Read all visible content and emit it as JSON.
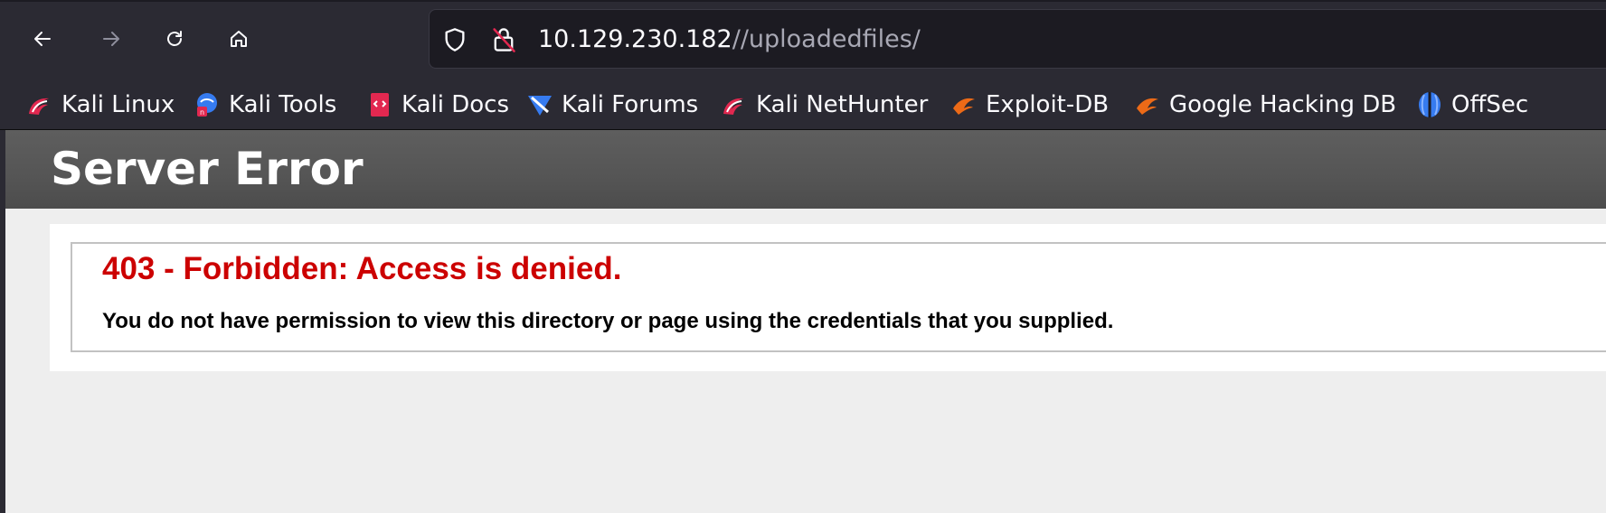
{
  "browser": {
    "nav": {
      "back": "back-icon",
      "forward": "forward-icon",
      "reload": "reload-icon",
      "home": "home-icon"
    },
    "urlbar": {
      "host": "10.129.230.182",
      "path": "//uploadedfiles/",
      "security_icon": "shield-icon",
      "lock_icon": "insecure-lock-icon"
    },
    "bookmarks": [
      {
        "label": "Kali Linux",
        "icon": "kali-dragon-icon"
      },
      {
        "label": "Kali Tools",
        "icon": "kali-tools-icon"
      },
      {
        "label": "Kali Docs",
        "icon": "kali-docs-icon"
      },
      {
        "label": "Kali Forums",
        "icon": "kali-forums-icon"
      },
      {
        "label": "Kali NetHunter",
        "icon": "kali-nethunter-icon"
      },
      {
        "label": "Exploit-DB",
        "icon": "exploit-db-icon"
      },
      {
        "label": "Google Hacking DB",
        "icon": "ghdb-icon"
      },
      {
        "label": "OffSec",
        "icon": "offsec-icon"
      }
    ]
  },
  "page": {
    "header_title": "Server Error",
    "error_title": "403 - Forbidden: Access is denied.",
    "error_message": "You do not have permission to view this directory or page using the credentials that you supplied."
  },
  "colors": {
    "chrome_bg": "#2b2a33",
    "urlbar_bg": "#1c1b22",
    "header_bg": "#555555",
    "error_red": "#cc0000",
    "page_bg": "#eeeeee"
  }
}
